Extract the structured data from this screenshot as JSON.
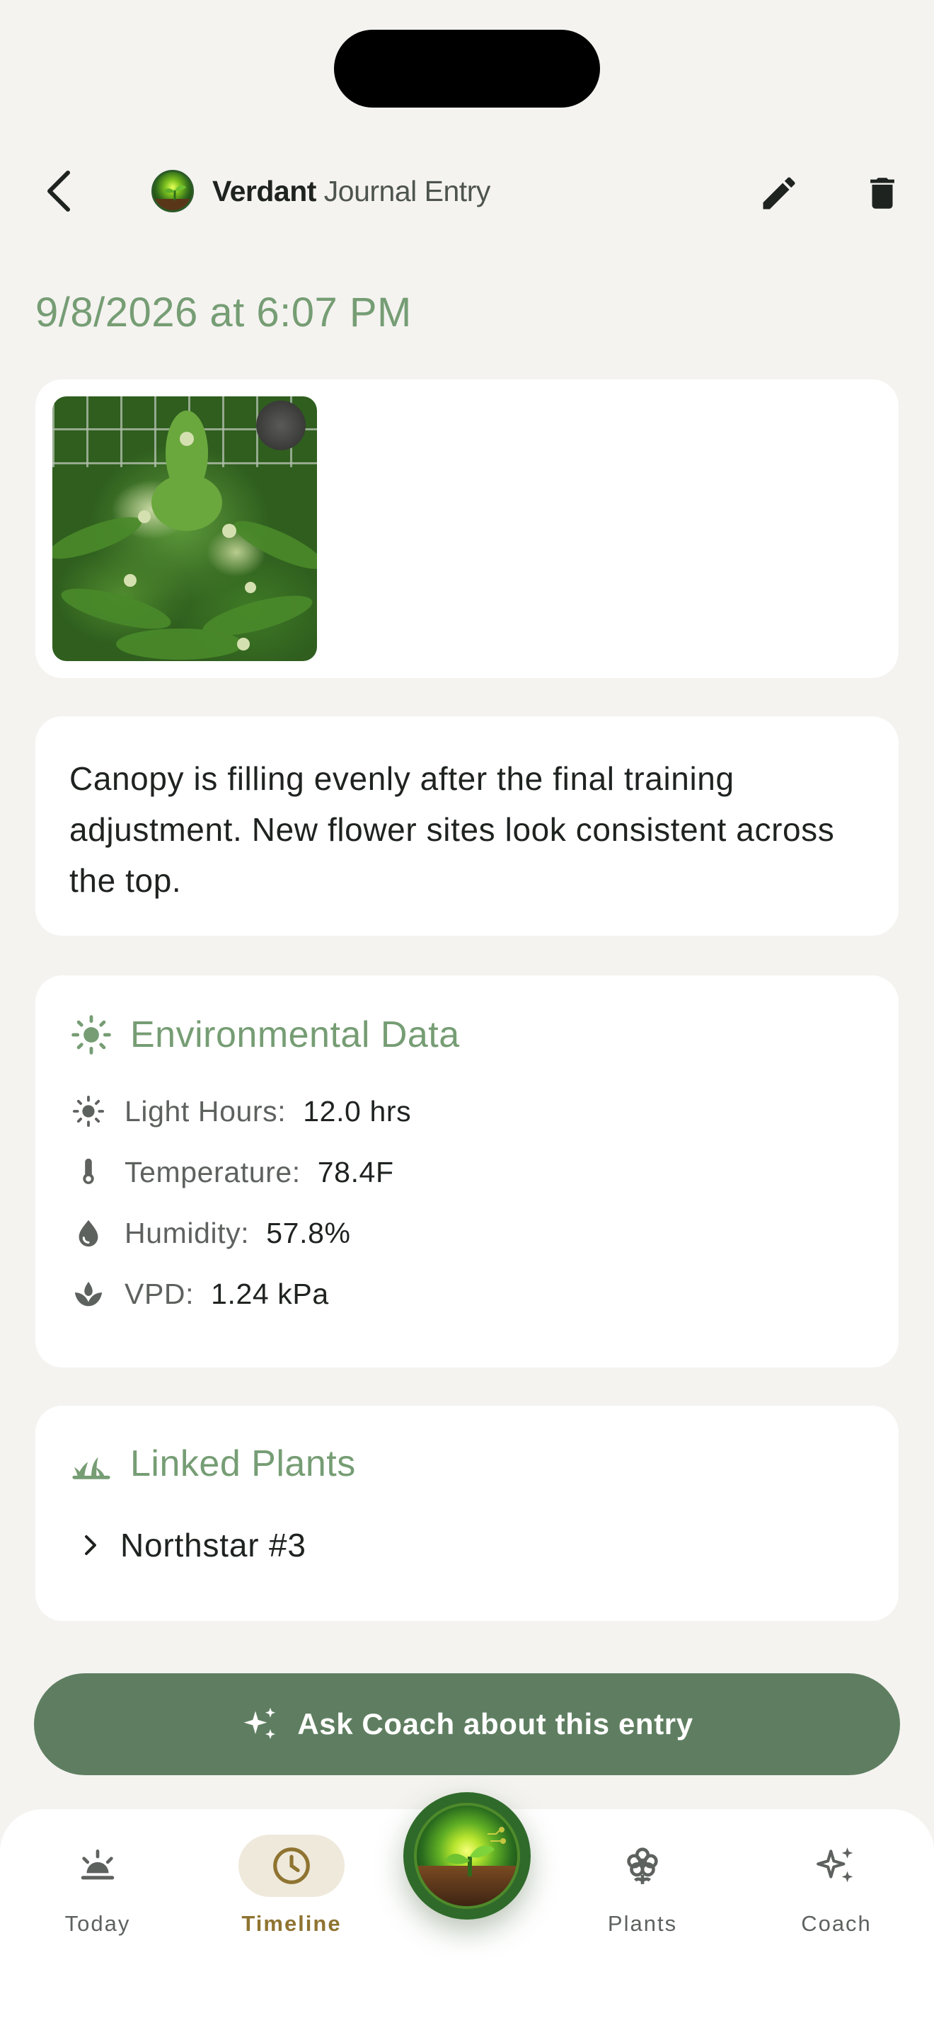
{
  "header": {
    "brand_bold": "Verdant",
    "brand_rest": "Journal Entry",
    "back_icon": "chevron-left-icon",
    "edit_icon": "pencil-icon",
    "delete_icon": "trash-icon"
  },
  "entry": {
    "datetime": "9/8/2026 at 6:07 PM",
    "note": "Canopy is filling evenly after the final training adjustment. New flower sites look consistent across the top."
  },
  "environment": {
    "title": "Environmental Data",
    "rows": [
      {
        "icon": "sun-icon",
        "label": "Light Hours:",
        "value": "12.0 hrs"
      },
      {
        "icon": "thermometer-icon",
        "label": "Temperature:",
        "value": "78.4F"
      },
      {
        "icon": "water-drop-icon",
        "label": "Humidity:",
        "value": "57.8%"
      },
      {
        "icon": "leaf-drop-icon",
        "label": "VPD:",
        "value": "1.24 kPa"
      }
    ]
  },
  "linked_plants": {
    "title": "Linked Plants",
    "items": [
      {
        "name": "Northstar #3"
      }
    ]
  },
  "coach_button": {
    "label": "Ask Coach about this entry"
  },
  "tabbar": {
    "tabs": [
      {
        "label": "Today",
        "active": false
      },
      {
        "label": "Timeline",
        "active": true
      },
      {
        "label": "Plants",
        "active": false
      },
      {
        "label": "Coach",
        "active": false
      }
    ]
  },
  "colors": {
    "accent_green": "#769d74",
    "button_green": "#5f7e61",
    "active_tab_gold": "#8f7431",
    "background": "#f4f3f0"
  }
}
